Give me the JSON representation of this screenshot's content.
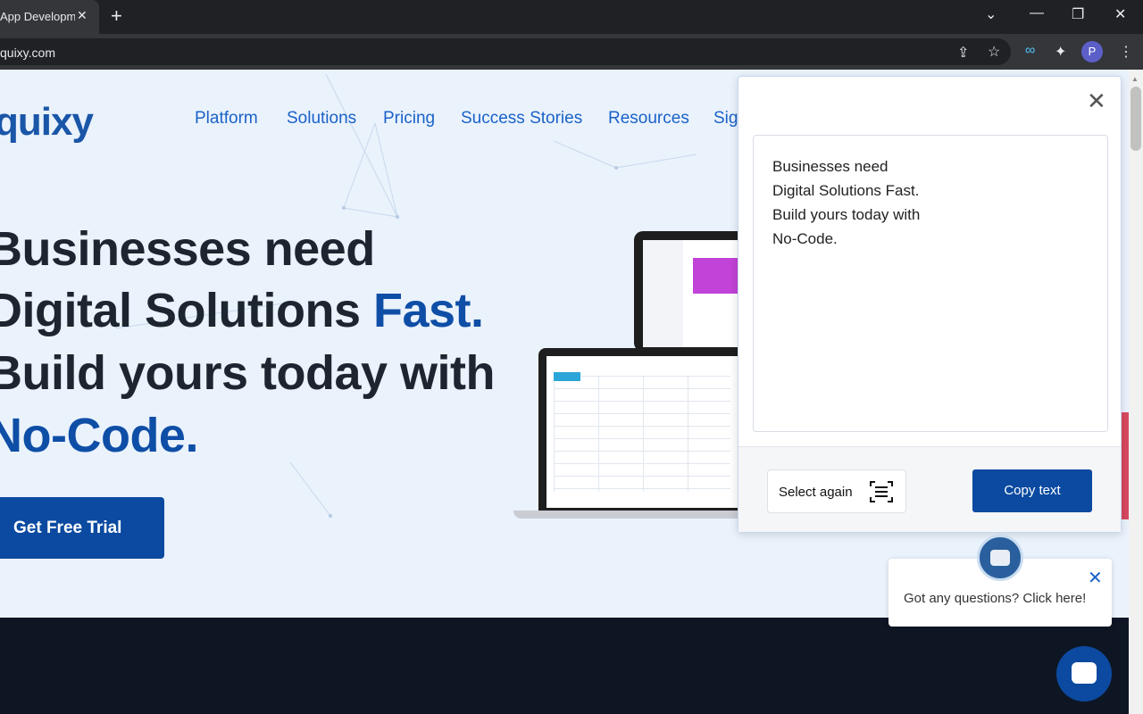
{
  "browser": {
    "tab_title": "App Development",
    "tab_close": "✕",
    "new_tab": "+",
    "url": "quixy.com",
    "profile_initial": "P",
    "window_controls": {
      "dropdown": "⌄",
      "minimize": "—",
      "restore": "❐",
      "close": "✕"
    },
    "toolbar_icons": {
      "share": "⇪",
      "star": "☆",
      "extension1": "∞",
      "puzzle": "✦",
      "menu": "⋮"
    }
  },
  "site": {
    "logo": "quixy",
    "nav": [
      "Platform",
      "Solutions",
      "Pricing",
      "Success Stories",
      "Resources",
      "Sig"
    ],
    "hero": {
      "line1": "Businesses need",
      "line2_prefix": "Digital Solutions ",
      "line2_accent": "Fast.",
      "line3": "Build yours today with",
      "line4_accent": "No-Code."
    },
    "cta_label": "Get Free Trial"
  },
  "popup": {
    "close": "✕",
    "extracted_text": [
      "Businesses need",
      "Digital Solutions Fast.",
      "Build yours today with",
      "No-Code."
    ],
    "select_again_label": "Select again",
    "copy_label": "Copy text"
  },
  "chat": {
    "prompt": "Got any questions? Click here!",
    "close": "✕"
  },
  "colors": {
    "brand_blue": "#0b4aa0",
    "nav_blue": "#1a62c8",
    "hero_bg": "#eaf2fc",
    "dark_band": "#0e1624"
  }
}
